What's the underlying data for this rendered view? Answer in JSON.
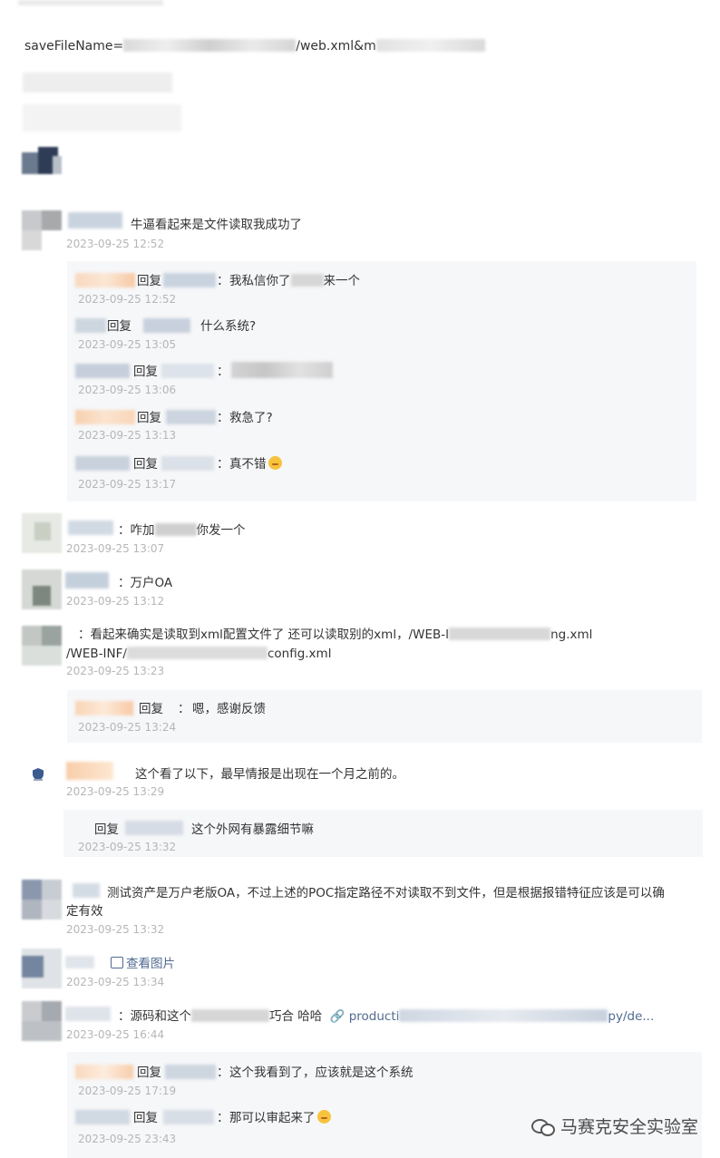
{
  "header": {
    "save_file_prefix": "saveFileName=",
    "save_file_suffix": "/web.xml&m"
  },
  "comments": [
    {
      "text": "牛逼看起来是文件读取我成功了",
      "time": "2023-09-25 12:52"
    },
    {
      "text": "：咋加",
      "text_after": "你发一个",
      "time": "2023-09-25 13:07"
    },
    {
      "text": "：万户OA",
      "time": "2023-09-25 13:12"
    },
    {
      "line1_a": "：看起来确实是读取到xml配置文件了 还可以读取别的xml，/WEB-I",
      "line1_b": "ng.xml",
      "line2_a": "/WEB-INF/",
      "line2_b": "config.xml",
      "time": "2023-09-25 13:23"
    },
    {
      "text": "这个看了以下，最早情报是出现在一个月之前的。",
      "time": "2023-09-25 13:29"
    },
    {
      "text": "测试资产是万户老版OA，不过上述的POC指定路径不对读取不到文件，但是根据报错特征应该是可以确",
      "text2": "定有效",
      "time": "2023-09-25 13:32"
    },
    {
      "link_text": "查看图片",
      "time": "2023-09-25 13:34"
    },
    {
      "text_a": "：源码和这个",
      "text_b": "巧合 哈哈",
      "link_a": "producti",
      "link_b": "py/de...",
      "time": "2023-09-25 16:44"
    }
  ],
  "replies": {
    "group1": [
      {
        "label": "回复",
        "sep": "：",
        "text_a": "我私信你了",
        "text_b": "来一个",
        "time": "2023-09-25 12:52"
      },
      {
        "label": "回复",
        "text": "什么系统?",
        "time": "2023-09-25 13:05"
      },
      {
        "label": "回复",
        "sep": "：",
        "time": "2023-09-25 13:06"
      },
      {
        "label": "回复",
        "sep": "：",
        "text": "救急了?",
        "time": "2023-09-25 13:13"
      },
      {
        "label": "回复",
        "sep": "：",
        "text": "真不错",
        "time": "2023-09-25 13:17"
      }
    ],
    "group2": [
      {
        "label": "回复",
        "sep": "：",
        "text": "嗯，感谢反馈",
        "time": "2023-09-25 13:24"
      }
    ],
    "group3": [
      {
        "label": "回复",
        "text": "这个外网有暴露细节嘛",
        "time": "2023-09-25 13:32"
      }
    ],
    "group4": [
      {
        "label": "回复",
        "sep": "：",
        "text": "这个我看到了，应该就是这个系统",
        "time": "2023-09-25 17:19"
      },
      {
        "label": "回复",
        "sep": "：",
        "text": "那可以审起来了",
        "time": "2023-09-25 23:43"
      }
    ]
  },
  "watermark": {
    "text": "马赛克安全实验室",
    "icon": "wechat-icon"
  }
}
